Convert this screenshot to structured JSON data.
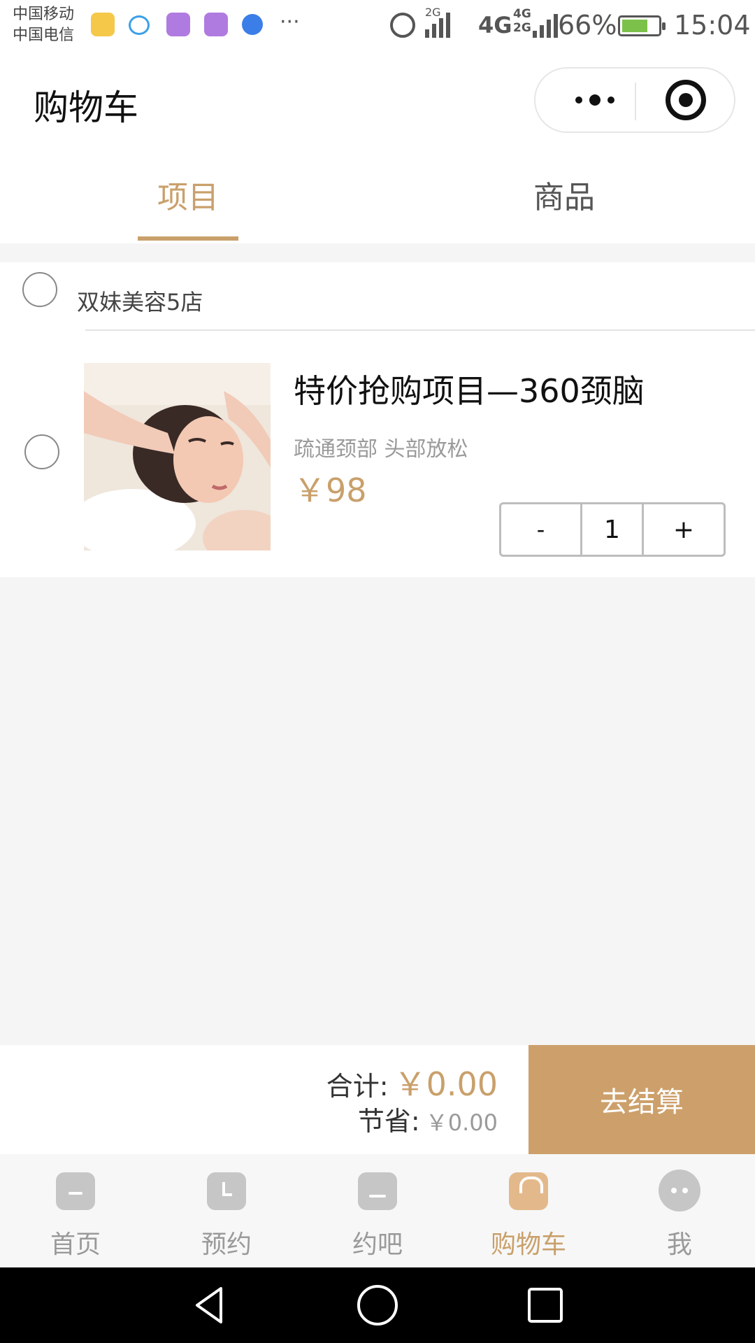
{
  "status_bar": {
    "carrier_1": "中国移动",
    "carrier_2": "中国电信",
    "network_1": "4G",
    "network_2a": "4G",
    "network_2b": "2G",
    "network_3": "2G",
    "battery": "66%",
    "time": "15:04",
    "icons": [
      "message-icon",
      "chat-icon",
      "gallery-icon",
      "keyboard-icon",
      "baidu-icon",
      "more-notifications-icon",
      "alarm-icon",
      "signal-icon",
      "battery-charging-icon"
    ],
    "colors": {
      "message": "#f5c84a",
      "chat": "#3aa0e8",
      "gallery": "#b07be0",
      "keyboard": "#b07be0",
      "baidu": "#3b7ee8",
      "battery_fill": "#7cc24a"
    }
  },
  "header": {
    "title": "购物车",
    "capsule": {
      "more_icon": "more-dots-icon",
      "close_icon": "target-close-icon"
    }
  },
  "tabs": [
    {
      "label": "项目",
      "active": true
    },
    {
      "label": "商品",
      "active": false
    }
  ],
  "cart": {
    "store_name": "双妹美容5店",
    "items": [
      {
        "title": "特价抢购项目—360颈脑",
        "description": "疏通颈部 头部放松",
        "price": "￥98",
        "quantity": "1",
        "image": "massage-photo"
      }
    ],
    "stepper": {
      "minus": "-",
      "plus": "+"
    }
  },
  "summary": {
    "total_label": "合计:",
    "total_value": "￥0.00",
    "save_label": "节省:",
    "save_value": "￥0.00",
    "checkout_label": "去结算"
  },
  "bottom_nav": [
    {
      "label": "首页",
      "icon": "home-icon",
      "active": false
    },
    {
      "label": "预约",
      "icon": "booking-icon",
      "active": false
    },
    {
      "label": "约吧",
      "icon": "meet-icon",
      "active": false
    },
    {
      "label": "购物车",
      "icon": "cart-bag-icon",
      "active": true
    },
    {
      "label": "我",
      "icon": "profile-icon",
      "active": false
    }
  ],
  "system_nav": [
    "back-icon",
    "home-circle-icon",
    "recents-icon"
  ],
  "colors": {
    "accent": "#c9a06b",
    "checkout": "#cda06b",
    "background": "#f5f5f5"
  }
}
